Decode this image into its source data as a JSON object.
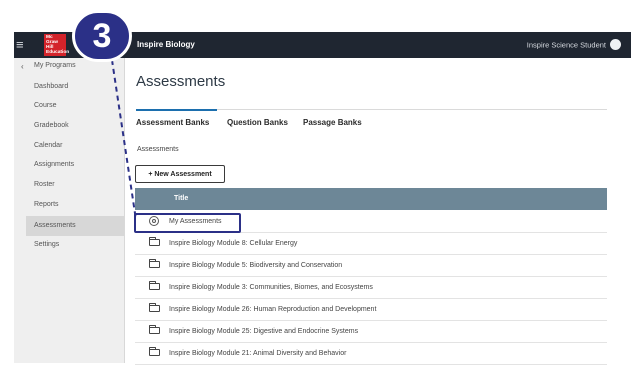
{
  "topbar": {
    "logo_text": "Mc Graw Hill Education",
    "app_title": "Inspire Biology",
    "user_name": "Inspire Science Student"
  },
  "sidebar": {
    "items": [
      {
        "label": "My Programs"
      },
      {
        "label": "Dashboard"
      },
      {
        "label": "Course"
      },
      {
        "label": "Gradebook"
      },
      {
        "label": "Calendar"
      },
      {
        "label": "Assignments"
      },
      {
        "label": "Roster"
      },
      {
        "label": "Reports"
      },
      {
        "label": "Assessments"
      },
      {
        "label": "Settings"
      }
    ]
  },
  "main": {
    "title": "Assessments",
    "tabs": [
      {
        "label": "Assessment Banks"
      },
      {
        "label": "Question Banks"
      },
      {
        "label": "Passage Banks"
      }
    ],
    "breadcrumb": "Assessments",
    "new_button": "+ New Assessment",
    "table_header": "Title",
    "rows": [
      {
        "label": "My Assessments",
        "icon": "person-circle-icon"
      },
      {
        "label": "Inspire Biology Module 8: Cellular Energy",
        "icon": "folder-icon"
      },
      {
        "label": "Inspire Biology Module 5: Biodiversity and Conservation",
        "icon": "folder-icon"
      },
      {
        "label": "Inspire Biology Module 3: Communities, Biomes, and Ecosystems",
        "icon": "folder-icon"
      },
      {
        "label": "Inspire Biology Module 26: Human Reproduction and Development",
        "icon": "folder-icon"
      },
      {
        "label": "Inspire Biology Module 25: Digestive and Endocrine Systems",
        "icon": "folder-icon"
      },
      {
        "label": "Inspire Biology Module 21: Animal Diversity and Behavior",
        "icon": "folder-icon"
      }
    ]
  },
  "callout": {
    "step_number": "3",
    "color": "#2b3087"
  },
  "colors": {
    "topbar": "#1f2631",
    "accent": "#1c6fae",
    "table_header": "#6d8797",
    "logo": "#d3232a"
  }
}
